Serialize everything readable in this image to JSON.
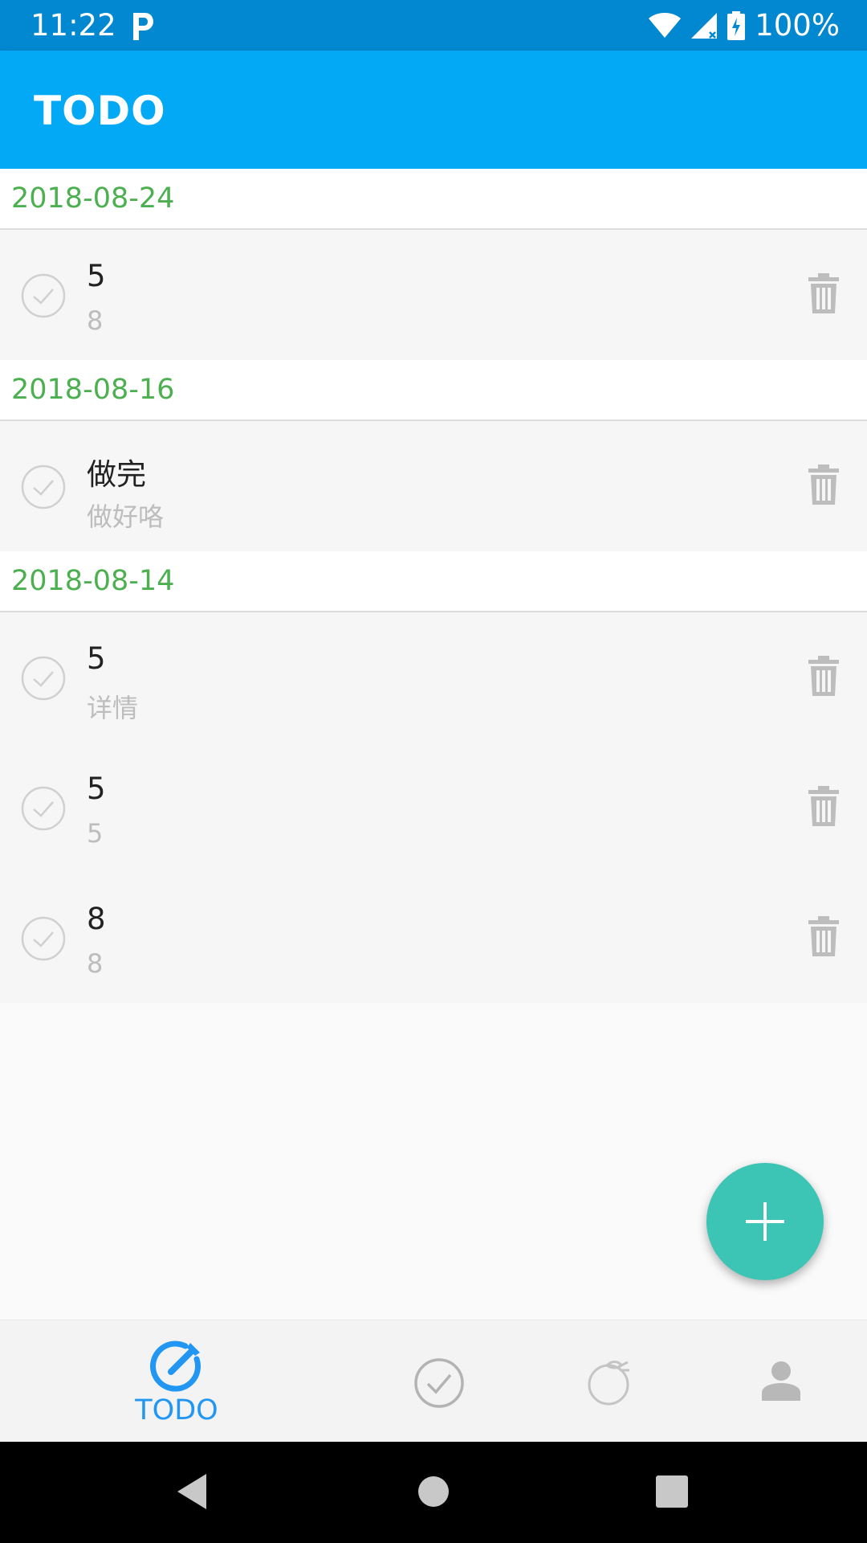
{
  "status_bar": {
    "time": "11:22",
    "battery": "100%"
  },
  "app_bar": {
    "title": "TODO"
  },
  "sections": [
    {
      "date": "2018-08-24",
      "items": [
        {
          "title": "5",
          "desc": "8"
        }
      ]
    },
    {
      "date": "2018-08-16",
      "items": [
        {
          "title": "做完",
          "desc": "做好咯"
        }
      ]
    },
    {
      "date": "2018-08-14",
      "items": [
        {
          "title": "5",
          "desc": "详情"
        },
        {
          "title": "5",
          "desc": "5"
        },
        {
          "title": "8",
          "desc": "8"
        }
      ]
    }
  ],
  "bottom_nav": {
    "todo_label": "TODO",
    "active_tab": "todo"
  },
  "colors": {
    "status_bar": "#0288d1",
    "app_bar": "#03a9f4",
    "date_text": "#4caf50",
    "fab": "#3cc4b4",
    "nav_active": "#2196f3"
  },
  "icons": {
    "fab": "plus-icon",
    "item_check": "check-circle-icon",
    "item_delete": "trash-icon",
    "nav_todo": "todo-edit-icon",
    "nav_done": "check-circle-icon",
    "nav_third": "fruit-icon",
    "nav_profile": "person-icon"
  }
}
